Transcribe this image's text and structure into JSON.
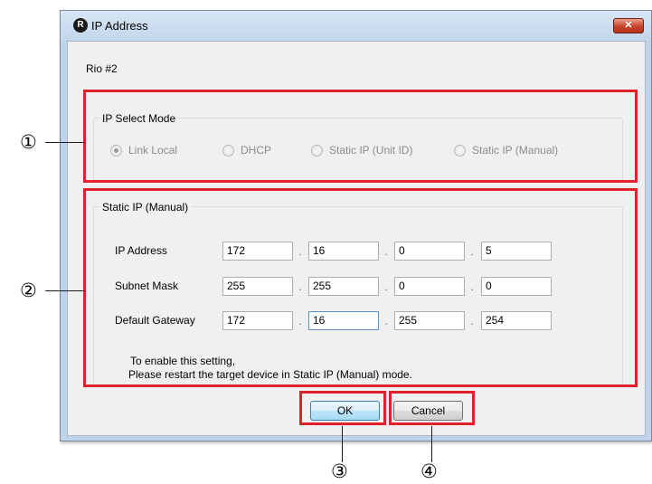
{
  "window": {
    "title": "IP Address",
    "app_icon_glyph": "R",
    "close_glyph": "✕"
  },
  "device_label": "Rio #2",
  "ip_select_mode": {
    "legend": "IP Select Mode",
    "options": [
      {
        "label": "Link Local",
        "selected": true,
        "enabled": false
      },
      {
        "label": "DHCP",
        "selected": false,
        "enabled": false
      },
      {
        "label": "Static IP (Unit ID)",
        "selected": false,
        "enabled": false
      },
      {
        "label": "Static IP (Manual)",
        "selected": false,
        "enabled": false
      }
    ]
  },
  "static_ip": {
    "legend": "Static IP (Manual)",
    "separator": ".",
    "rows": [
      {
        "label": "IP Address",
        "octets": [
          "172",
          "16",
          "0",
          "5"
        ]
      },
      {
        "label": "Subnet Mask",
        "octets": [
          "255",
          "255",
          "0",
          "0"
        ]
      },
      {
        "label": "Default Gateway",
        "octets": [
          "172",
          "16",
          "255",
          "254"
        ]
      }
    ],
    "note_line1": "To enable this setting,",
    "note_line2": "Please restart the target device in Static IP (Manual) mode."
  },
  "buttons": {
    "ok": "OK",
    "cancel": "Cancel"
  },
  "callouts": [
    "①",
    "②",
    "③",
    "④"
  ],
  "colors": {
    "callout_border": "#e0202b",
    "window_frame": "#bfd3ea",
    "dialog_background": "#f0f0f0",
    "close_button": "#c7422a"
  },
  "icons": {
    "app": "app-logo-icon",
    "close": "close-icon"
  }
}
